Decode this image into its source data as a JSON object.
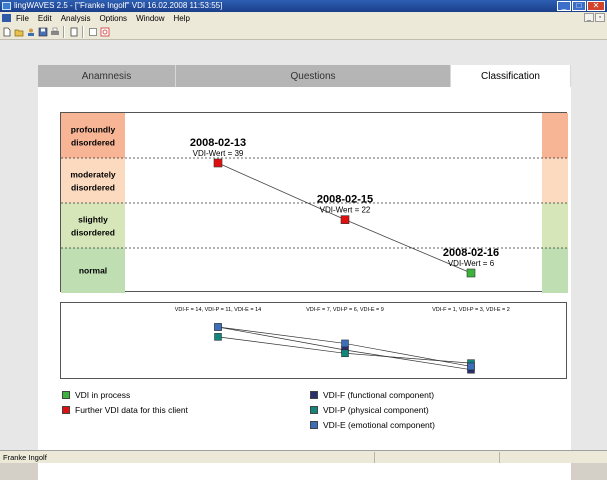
{
  "window": {
    "title": "lingWAVES 2.5 - [\"Franke Ingolf\" VDI  16.02.2008 11:53:55]"
  },
  "menu": {
    "items": [
      "File",
      "Edit",
      "Analysis",
      "Options",
      "Window",
      "Help"
    ]
  },
  "toolbar": {
    "icons": [
      "new-doc-icon",
      "open-folder-icon",
      "client-icon",
      "save-icon",
      "print-icon",
      "blank-doc-icon",
      "checkbox-icon",
      "image-icon"
    ]
  },
  "tabs": [
    {
      "label": "Anamnesis",
      "active": false
    },
    {
      "label": "Questions",
      "active": false
    },
    {
      "label": "Classification",
      "active": true
    }
  ],
  "colors": {
    "profound": "#f7b596",
    "moderate": "#fcdac0",
    "slight": "#d6e6b8",
    "normal": "#bfdfb3",
    "marker_red": "#e01010",
    "marker_green": "#3cb43c",
    "vdi_f": "#2b2f6e",
    "vdi_p": "#13857a",
    "vdi_e": "#3c6fb8"
  },
  "severity_levels": [
    {
      "label": "profoundly disordered",
      "color": "#f7b596"
    },
    {
      "label": "moderately disordered",
      "color": "#fcdac0"
    },
    {
      "label": "slightly disordered",
      "color": "#d6e6b8"
    },
    {
      "label": "normal",
      "color": "#bfdfb3"
    }
  ],
  "chart_data": [
    {
      "type": "scatter",
      "series": [
        {
          "name": "Further VDI data for this client",
          "points": [
            {
              "date": "2008-02-13",
              "label": "VDI-Wert = 39",
              "y": 39
            },
            {
              "date": "2008-02-15",
              "label": "VDI-Wert = 22",
              "y": 22
            }
          ]
        },
        {
          "name": "VDI in process",
          "points": [
            {
              "date": "2008-02-16",
              "label": "VDI-Wert = 6",
              "y": 6
            }
          ]
        }
      ],
      "ylim": [
        0,
        54
      ]
    },
    {
      "type": "line",
      "categories": [
        "2008-02-13",
        "2008-02-15",
        "2008-02-16"
      ],
      "category_labels": [
        "VDI-F = 14, VDI-P = 11, VDI-E = 14",
        "VDI-F = 7, VDI-P = 6, VDI-E = 9",
        "VDI-F = 1, VDI-P = 3, VDI-E = 2"
      ],
      "series": [
        {
          "name": "VDI-F (functional component)",
          "values": [
            14,
            7,
            1
          ]
        },
        {
          "name": "VDI-P (physical component)",
          "values": [
            11,
            6,
            3
          ]
        },
        {
          "name": "VDI-E (emotional component)",
          "values": [
            14,
            9,
            2
          ]
        }
      ]
    }
  ],
  "legend": [
    {
      "label": "VDI in process",
      "color": "#3cb43c"
    },
    {
      "label": "Further VDI data for this client",
      "color": "#e01010"
    },
    {
      "label": "VDI-F (functional component)",
      "color": "#2b2f6e"
    },
    {
      "label": "VDI-P (physical component)",
      "color": "#13857a"
    },
    {
      "label": "VDI-E (emotional component)",
      "color": "#3c6fb8"
    }
  ],
  "status": {
    "user": "Franke Ingolf"
  }
}
